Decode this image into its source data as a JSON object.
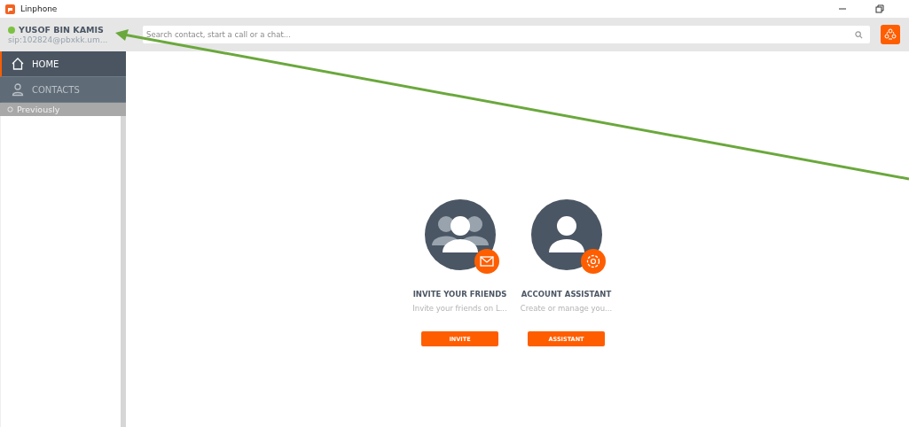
{
  "window": {
    "title": "Linphone"
  },
  "account": {
    "name": "YUSOF BIN KAMIS",
    "address": "sip:102824@pbxkk.um...",
    "color": "#7cc242"
  },
  "search": {
    "placeholder": "Search contact, start a call or a chat..."
  },
  "menu": [
    {
      "label": "HOME",
      "kind": "home",
      "selected": true
    },
    {
      "label": "CONTACTS",
      "kind": "contacts",
      "selected": false
    }
  ],
  "history": {
    "label": "Previously"
  },
  "cards": [
    {
      "kind": "invite",
      "title": "INVITE YOUR FRIENDS",
      "description": "Invite your friends on L...",
      "button": "INVITE"
    },
    {
      "kind": "assistant",
      "title": "ACCOUNT ASSISTANT",
      "description": "Create or manage you...",
      "button": "ASSISTANT"
    }
  ]
}
